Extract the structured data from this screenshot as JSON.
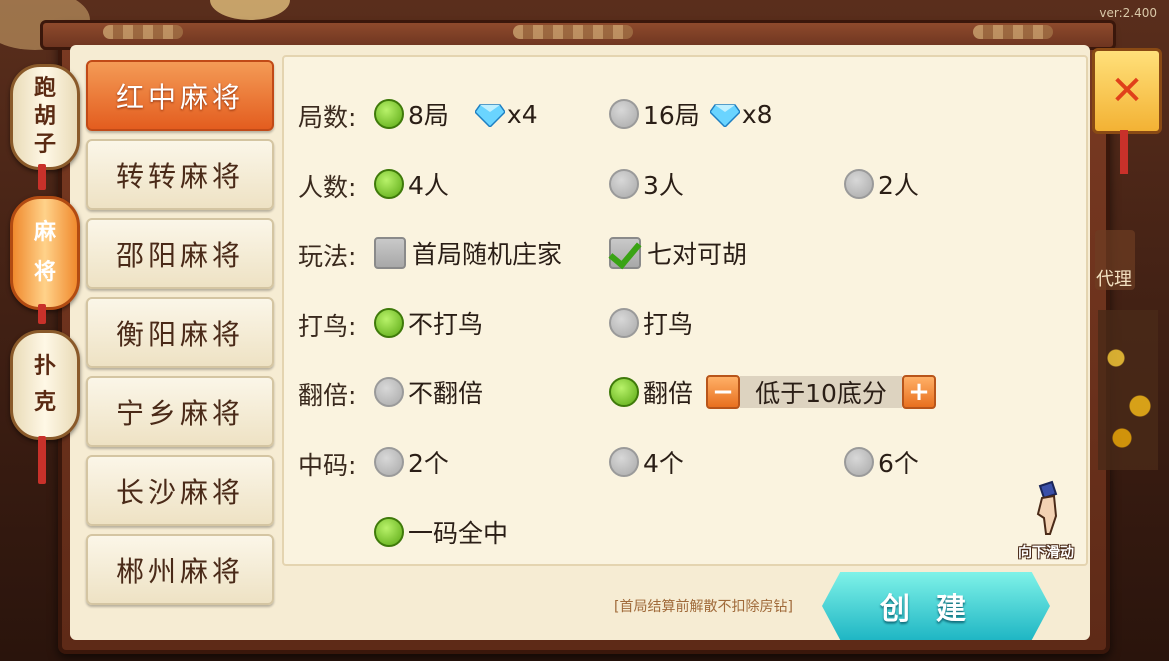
{
  "version": "ver:2.400",
  "side_tabs": [
    {
      "label": "跑胡子",
      "chars": [
        "跑",
        "胡",
        "子"
      ],
      "active": false
    },
    {
      "label": "麻将",
      "chars": [
        "麻",
        "将"
      ],
      "active": true
    },
    {
      "label": "扑克",
      "chars": [
        "扑",
        "克"
      ],
      "active": false
    }
  ],
  "games": [
    {
      "label": "红中麻将",
      "active": true
    },
    {
      "label": "转转麻将",
      "active": false
    },
    {
      "label": "邵阳麻将",
      "active": false
    },
    {
      "label": "衡阳麻将",
      "active": false
    },
    {
      "label": "宁乡麻将",
      "active": false
    },
    {
      "label": "长沙麻将",
      "active": false
    },
    {
      "label": "郴州麻将",
      "active": false
    }
  ],
  "rows": {
    "rounds": {
      "label": "局数:",
      "opt1": "8局",
      "opt1_cost": "x4",
      "opt2": "16局",
      "opt2_cost": "x8",
      "selected": "8局"
    },
    "players": {
      "label": "人数:",
      "opt1": "4人",
      "opt2": "3人",
      "opt3": "2人",
      "selected": "4人"
    },
    "rules": {
      "label": "玩法:",
      "opt1": "首局随机庄家",
      "opt1_checked": false,
      "opt2": "七对可胡",
      "opt2_checked": true
    },
    "bird": {
      "label": "打鸟:",
      "opt1": "不打鸟",
      "opt2": "打鸟",
      "selected": "不打鸟"
    },
    "double": {
      "label": "翻倍:",
      "opt1": "不翻倍",
      "opt2": "翻倍",
      "selected": "翻倍",
      "stepper_value": "低于10底分"
    },
    "codes": {
      "label": "中码:",
      "opt1": "2个",
      "opt2": "4个",
      "opt3": "6个",
      "opt4": "一码全中",
      "selected": "一码全中"
    }
  },
  "scroll_hint": "向下滑动",
  "notice": "[首局结算前解散不扣除房钻]",
  "create_label": "创建",
  "right_label": "代理",
  "colors": {
    "accent_orange": "#e35d1f",
    "radio_on": "#5aa813",
    "create_btn": "#1fb6c4"
  }
}
